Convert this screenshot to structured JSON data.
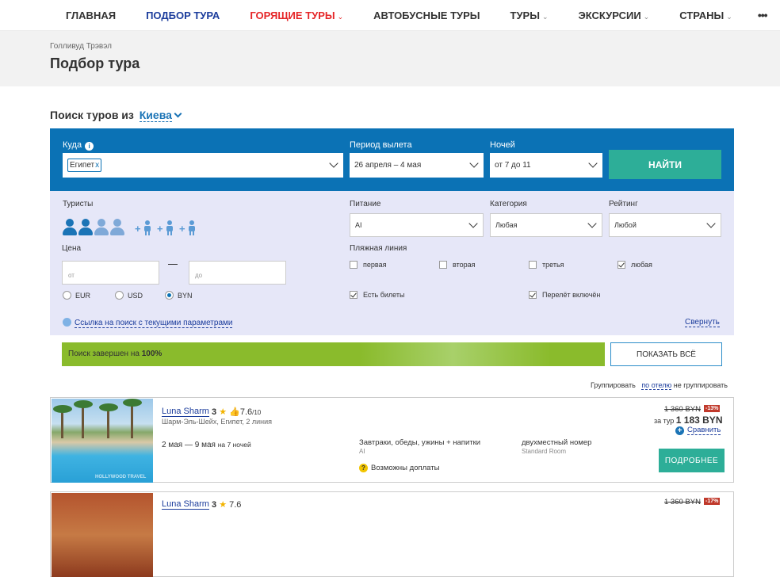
{
  "nav": {
    "items": [
      {
        "label": "ГЛАВНАЯ",
        "dropdown": false,
        "style": "normal"
      },
      {
        "label": "ПОДБОР ТУРА",
        "dropdown": false,
        "style": "active"
      },
      {
        "label": "ГОРЯЩИЕ ТУРЫ",
        "dropdown": true,
        "style": "hot"
      },
      {
        "label": "АВТОБУСНЫЕ ТУРЫ",
        "dropdown": false,
        "style": "normal"
      },
      {
        "label": "ТУРЫ",
        "dropdown": true,
        "style": "normal"
      },
      {
        "label": "ЭКСКУРСИИ",
        "dropdown": true,
        "style": "normal"
      },
      {
        "label": "СТРАНЫ",
        "dropdown": true,
        "style": "normal"
      }
    ],
    "more": "•••"
  },
  "breadcrumb": "Голливуд Трэвэл",
  "page_title": "Подбор тура",
  "search_from": {
    "label": "Поиск туров из",
    "city": "Киева"
  },
  "search": {
    "where_label": "Куда",
    "where_tag": "Египет",
    "where_tag_remove": "x",
    "period_label": "Период вылета",
    "period_value": "26 апреля – 4 мая",
    "nights_label": "Ночей",
    "nights_value": "от 7 до 11",
    "find_button": "НАЙТИ"
  },
  "filters": {
    "tourists_label": "Туристы",
    "adults_selected": 2,
    "adults_max": 4,
    "price_label": "Цена",
    "price_from_placeholder": "от",
    "price_to_placeholder": "до",
    "currencies": [
      {
        "label": "EUR",
        "selected": false
      },
      {
        "label": "USD",
        "selected": false
      },
      {
        "label": "BYN",
        "selected": true
      }
    ],
    "meal_label": "Питание",
    "meal_value": "AI",
    "category_label": "Категория",
    "category_value": "Любая",
    "rating_label": "Рейтинг",
    "rating_value": "Любой",
    "beach_label": "Пляжная линия",
    "beach_options": [
      {
        "label": "первая",
        "checked": false
      },
      {
        "label": "вторая",
        "checked": false
      },
      {
        "label": "третья",
        "checked": false
      },
      {
        "label": "любая",
        "checked": true
      }
    ],
    "tickets_label": "Есть билеты",
    "tickets_checked": true,
    "flight_label": "Перелёт включён",
    "flight_checked": true,
    "link_text": "Ссылка на поиск с текущими параметрами",
    "collapse_text": "Свернуть"
  },
  "progress": {
    "text": "Поиск завершен на",
    "percent_label": "100%",
    "percent": 100
  },
  "show_all": "ПОКАЗАТЬ ВСЁ",
  "grouping": {
    "label": "Группировать",
    "by_hotel": "по отелю",
    "none": "не группировать"
  },
  "results": [
    {
      "hotel": "Luna Sharm",
      "stars": "3",
      "rating": "7.6",
      "rating_max": "/10",
      "location": "Шарм-Эль-Шейх, Египет, 2 линия",
      "dates": "2 мая — 9 мая",
      "nights": "на 7 ночей",
      "meal": "Завтраки, обеды, ужины + напитки",
      "meal_code": "AI",
      "room": "двухместный номер",
      "room_type": "Standard Room",
      "extra": "Возможны доплаты",
      "old_price": "1 360 BYN",
      "discount": "-13%",
      "price_prefix": "за тур",
      "price": "1 183 BYN",
      "compare": "Сравнить",
      "details_button": "ПОДРОБНЕЕ",
      "photo_watermark": "HOLLYWOOD TRAVEL"
    },
    {
      "hotel": "Luna Sharm",
      "stars": "3",
      "rating": "7.6",
      "old_price": "1 360 BYN",
      "discount": "-17%"
    }
  ],
  "colors": {
    "brand_blue": "#0b72b5",
    "nav_active": "#1b3c9c",
    "hot": "#e52527",
    "accent_green": "#2dae98",
    "progress_green": "#8abb2c",
    "filter_bg": "#e6e7f8"
  }
}
